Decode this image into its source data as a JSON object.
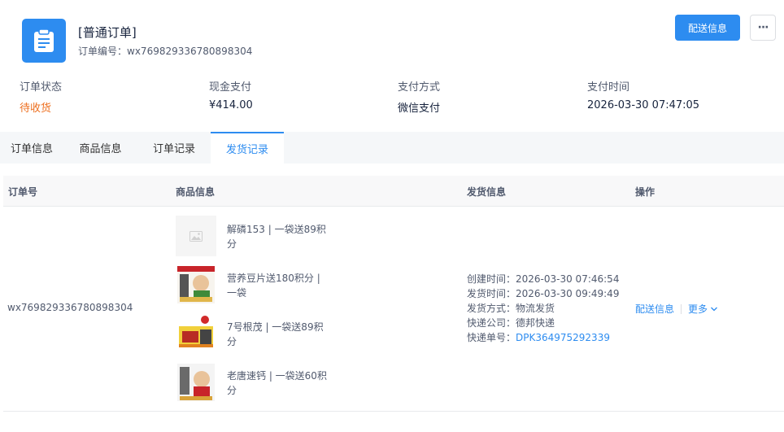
{
  "header": {
    "title": "[普通订单]",
    "order_no_label": "订单编号：",
    "order_no": "wx769829336780898304",
    "primary_button": "配送信息",
    "more_glyph": "···"
  },
  "summary": [
    {
      "label": "订单状态",
      "value": "待收货"
    },
    {
      "label": "现金支付",
      "value": "¥414.00"
    },
    {
      "label": "支付方式",
      "value": "微信支付"
    },
    {
      "label": "支付时间",
      "value": "2026-03-30 07:47:05"
    }
  ],
  "tabs": [
    {
      "label": "订单信息",
      "active": false
    },
    {
      "label": "商品信息",
      "active": false
    },
    {
      "label": "订单记录",
      "active": false
    },
    {
      "label": "发货记录",
      "active": true
    }
  ],
  "table": {
    "headers": [
      "订单号",
      "商品信息",
      "发货信息",
      "操作"
    ],
    "row": {
      "order_no": "wx769829336780898304",
      "products": [
        {
          "name": "解磷153 | 一袋送89积分",
          "thumb": "placeholder-image-icon"
        },
        {
          "name": "营养豆片送180积分 | 一袋",
          "thumb": "product-package-image"
        },
        {
          "name": "7号根茂 | 一袋送89积分",
          "thumb": "product-package-image"
        },
        {
          "name": "老唐速钙 | 一袋送60积分",
          "thumb": "product-package-image"
        }
      ],
      "shipping": [
        {
          "label": "创建时间：",
          "value": "2026-03-30 07:46:54"
        },
        {
          "label": "发货时间：",
          "value": "2026-03-30 09:49:49"
        },
        {
          "label": "发货方式：",
          "value": "物流发货"
        },
        {
          "label": "快递公司：",
          "value": "德邦快递"
        },
        {
          "label": "快递单号：",
          "value": "DPK364975292339"
        }
      ],
      "actions": {
        "delivery": "配送信息",
        "more": "更多"
      }
    }
  },
  "colors": {
    "accent": "#2d8cf0",
    "status": "#ed6f1f"
  }
}
